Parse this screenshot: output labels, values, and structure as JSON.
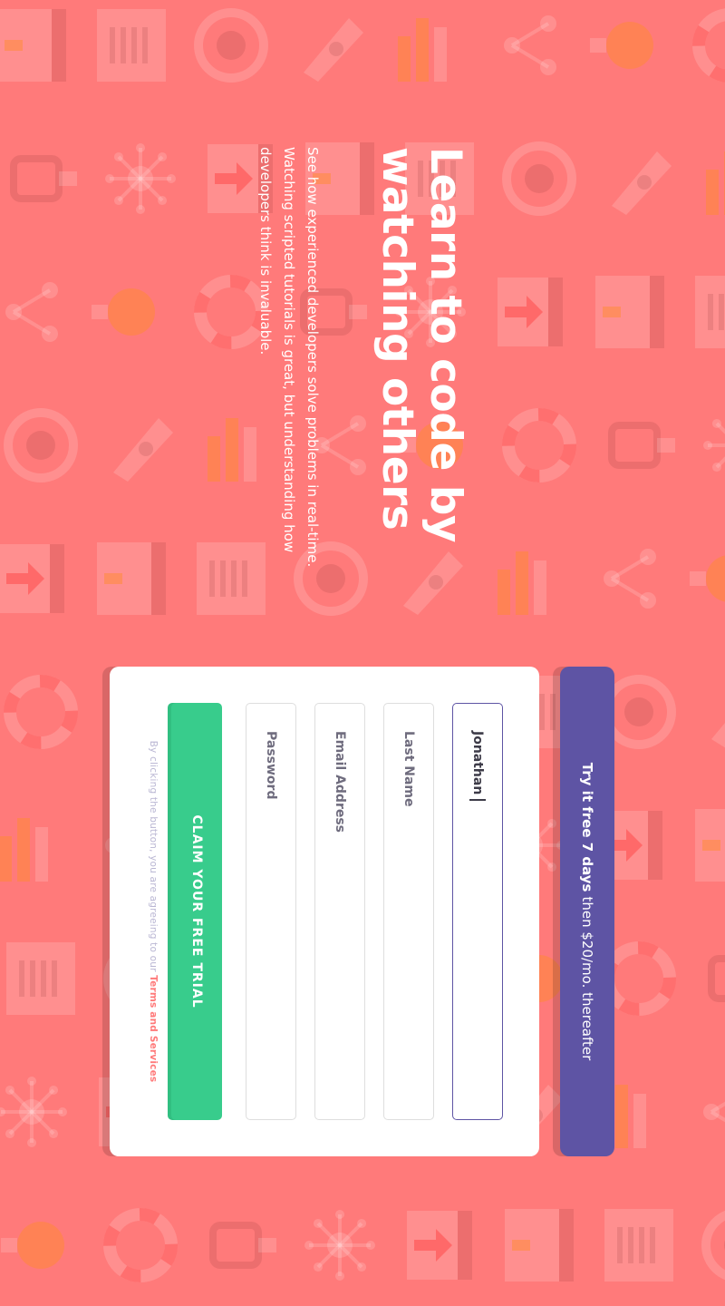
{
  "hero": {
    "headline": "Learn to code by watching others",
    "description": "See how experienced developers solve problems in real-time. Watching scripted tutorials is great, but understanding how developers think is invaluable."
  },
  "promo": {
    "highlight": "Try it free 7 days",
    "rest": "then $20/mo. thereafter"
  },
  "form": {
    "first_name": {
      "value": "Jonathan"
    },
    "last_name": {
      "placeholder": "Last Name"
    },
    "email": {
      "placeholder": "Email Address"
    },
    "password": {
      "placeholder": "Password"
    },
    "submit_label": "CLAIM YOUR FREE TRIAL",
    "terms_prefix": "By clicking the button, you are agreeing to our",
    "terms_link": "Terms and Services"
  },
  "colors": {
    "background": "#ff7a7a",
    "promo": "#5e54a4",
    "button": "#38cc8c",
    "accent_link": "#ff7a7a"
  },
  "background_icons": [
    "server-icon",
    "cabinet-icon",
    "globe-gear-icon",
    "rocket-icon",
    "bar-chart-icon",
    "network-icon",
    "bulb-icon",
    "lifebuoy-icon",
    "plug-icon",
    "virus-icon",
    "arrow-box-icon"
  ]
}
